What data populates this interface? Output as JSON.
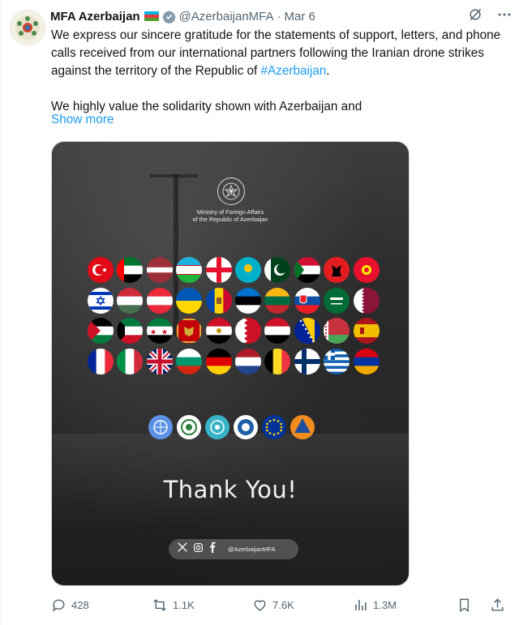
{
  "account": {
    "name": "MFA Azerbaijan",
    "handle": "@AzerbaijanMFA",
    "date": "Mar 6",
    "separator": "·"
  },
  "tweet": {
    "text_before_hashtag": "We express our sincere gratitude for the statements of support, letters, and phone calls received from our international partners following the Iranian drone strikes against the territory of the Republic of ",
    "hashtag": "#Azerbaijan",
    "text_after_hashtag": ".",
    "paragraph2": "We highly value the solidarity shown with Azerbaijan and",
    "show_more": "Show more"
  },
  "media": {
    "ministry_line1": "Ministry of Foreign Affairs",
    "ministry_line2": "of the Republic of Azerbaijan",
    "thank_you": "Thank You!",
    "social_handle": "@AzerbaijanMFA",
    "flags": [
      [
        "turkey",
        "uae",
        "latvia",
        "uzbekistan",
        "georgia",
        "kazakhstan",
        "pakistan",
        "sudan",
        "albania",
        "kyrgyzstan"
      ],
      [
        "israel",
        "hungary",
        "austria",
        "ukraine",
        "moldova",
        "estonia",
        "lithuania",
        "slovakia",
        "saudi-arabia",
        "qatar"
      ],
      [
        "jordan",
        "kuwait",
        "syria",
        "montenegro",
        "egypt",
        "bahrain",
        "yemen",
        "bosnia",
        "belarus",
        "spain"
      ],
      [
        "france",
        "italy",
        "uk",
        "bulgaria",
        "germany",
        "netherlands",
        "belgium",
        "finland",
        "greece",
        "armenia"
      ]
    ],
    "organizations": [
      "united-nations",
      "oic",
      "turkic-states",
      "gcc",
      "european-union",
      "civil-defence"
    ]
  },
  "actions": {
    "replies": "428",
    "reposts": "1.1K",
    "likes": "7.6K",
    "views": "1.3M"
  },
  "colors": {
    "accent": "#1d9bf0",
    "secondary_text": "#536471",
    "verified": "#829aab"
  }
}
